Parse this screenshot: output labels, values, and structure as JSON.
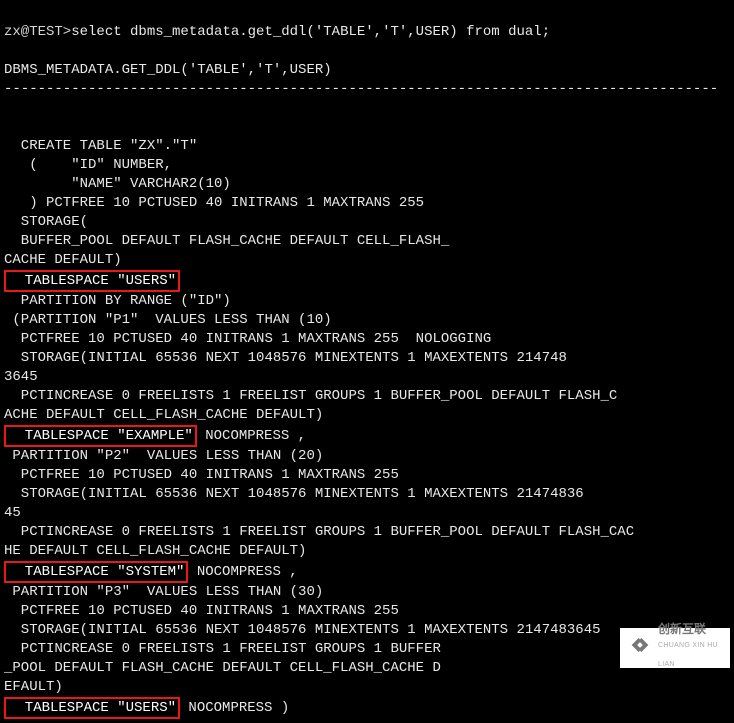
{
  "prompt": {
    "user_host": "zx@TEST>",
    "command": "select dbms_metadata.get_ddl('TABLE','T',USER) from dual;"
  },
  "header": {
    "label": "DBMS_METADATA.GET_DDL('TABLE','T',USER)",
    "dashline": "-------------------------------------------------------------------------------------"
  },
  "body": {
    "l1": "  CREATE TABLE \"ZX\".\"T\"",
    "l2": "   (    \"ID\" NUMBER,",
    "l3": "        \"NAME\" VARCHAR2(10)",
    "l4": "   ) PCTFREE 10 PCTUSED 40 INITRANS 1 MAXTRANS 255",
    "l5": "  STORAGE(",
    "l6": "  BUFFER_POOL DEFAULT FLASH_CACHE DEFAULT CELL_FLASH_",
    "l7a": "CACHE DEFAULT)",
    "hl1": "  TABLESPACE \"USERS\"",
    "l8": "  PARTITION BY RANGE (\"ID\")",
    "l9": " (PARTITION \"P1\"  VALUES LESS THAN (10)",
    "l10": "  PCTFREE 10 PCTUSED 40 INITRANS 1 MAXTRANS 255  NOLOGGING",
    "l11": "  STORAGE(INITIAL 65536 NEXT 1048576 MINEXTENTS 1 MAXEXTENTS 214748",
    "l12": "3645",
    "l13": "  PCTINCREASE 0 FREELISTS 1 FREELIST GROUPS 1 BUFFER_POOL DEFAULT FLASH_C",
    "l14": "ACHE DEFAULT CELL_FLASH_CACHE DEFAULT)",
    "hl2": "  TABLESPACE \"EXAMPLE\"",
    "l15": " NOCOMPRESS ,",
    "l16": " PARTITION \"P2\"  VALUES LESS THAN (20)",
    "l17": "  PCTFREE 10 PCTUSED 40 INITRANS 1 MAXTRANS 255",
    "l18": "  STORAGE(INITIAL 65536 NEXT 1048576 MINEXTENTS 1 MAXEXTENTS 21474836",
    "l19": "45",
    "l20": "  PCTINCREASE 0 FREELISTS 1 FREELIST GROUPS 1 BUFFER_POOL DEFAULT FLASH_CAC",
    "l21": "HE DEFAULT CELL_FLASH_CACHE DEFAULT)",
    "hl3": "  TABLESPACE \"SYSTEM\"",
    "l22": " NOCOMPRESS ,",
    "l23": " PARTITION \"P3\"  VALUES LESS THAN (30)",
    "l24": "  PCTFREE 10 PCTUSED 40 INITRANS 1 MAXTRANS 255",
    "l25": "  STORAGE(INITIAL 65536 NEXT 1048576 MINEXTENTS 1 MAXEXTENTS 2147483645",
    "l26": "  PCTINCREASE 0 FREELISTS 1 FREELIST GROUPS 1 BUFFER",
    "l27": "_POOL DEFAULT FLASH_CACHE DEFAULT CELL_FLASH_CACHE D",
    "l28": "EFAULT)",
    "hl4": "  TABLESPACE \"USERS\"",
    "l29": " NOCOMPRESS )"
  },
  "watermark": {
    "brand": "创新互联",
    "sub": "CHUANG XIN HU LIAN"
  }
}
